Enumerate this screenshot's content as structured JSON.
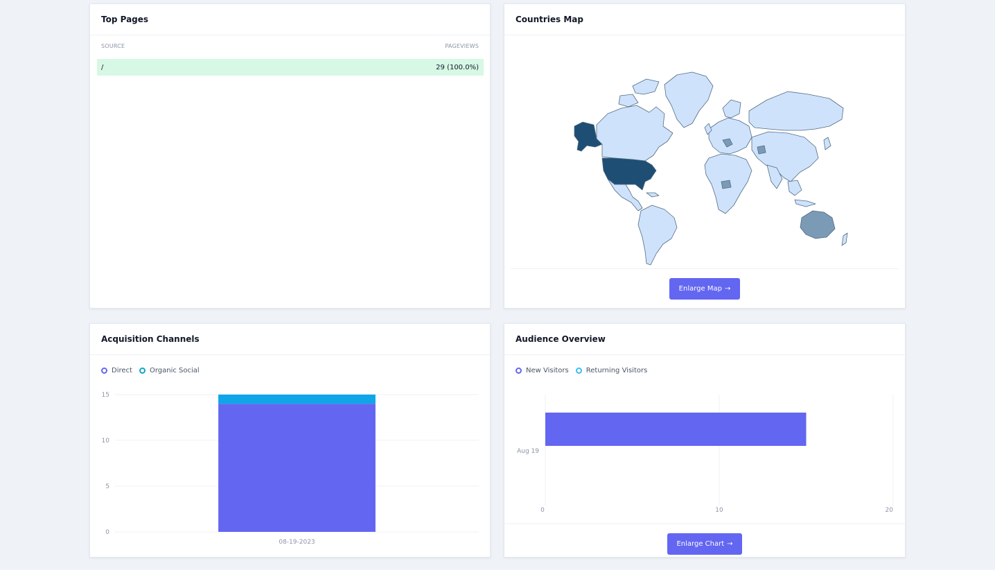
{
  "top_pages": {
    "title": "Top Pages",
    "col_source": "SOURCE",
    "col_pageviews": "PAGEVIEWS",
    "rows": [
      {
        "source": "/",
        "pageviews": "29 (100.0%)"
      }
    ]
  },
  "countries_map": {
    "title": "Countries Map",
    "button_label": "Enlarge Map",
    "colors": {
      "high": "#1e4e73",
      "mid": "#7b9ab5",
      "low": "#cfe2fb",
      "border": "#506b84"
    }
  },
  "acquisition": {
    "title": "Acquisition Channels",
    "legend": [
      {
        "label": "Direct",
        "color": "#6366f1"
      },
      {
        "label": "Organic Social",
        "color": "#0ea5c9"
      }
    ]
  },
  "audience": {
    "title": "Audience Overview",
    "legend": [
      {
        "label": "New Visitors",
        "color": "#6366f1"
      },
      {
        "label": "Returning Visitors",
        "color": "#38bdf8"
      }
    ],
    "button_label": "Enlarge Chart"
  },
  "chart_data": [
    {
      "type": "bar",
      "stacked": true,
      "categories": [
        "08-19-2023"
      ],
      "series": [
        {
          "name": "Direct",
          "values": [
            14
          ],
          "color": "#6366f1"
        },
        {
          "name": "Organic Social",
          "values": [
            1
          ],
          "color": "#0ea5e9"
        }
      ],
      "y_ticks": [
        "15",
        "10",
        "5",
        "0"
      ],
      "ylim": [
        0,
        15
      ],
      "grid": true
    },
    {
      "type": "bar",
      "orientation": "horizontal",
      "categories": [
        "Aug 19"
      ],
      "series": [
        {
          "name": "New Visitors",
          "values": [
            15
          ],
          "color": "#6366f1"
        },
        {
          "name": "Returning Visitors",
          "values": [
            0
          ],
          "color": "#38bdf8"
        }
      ],
      "x_ticks": [
        "0",
        "10",
        "20"
      ],
      "xlim": [
        0,
        20
      ],
      "grid": true
    }
  ]
}
